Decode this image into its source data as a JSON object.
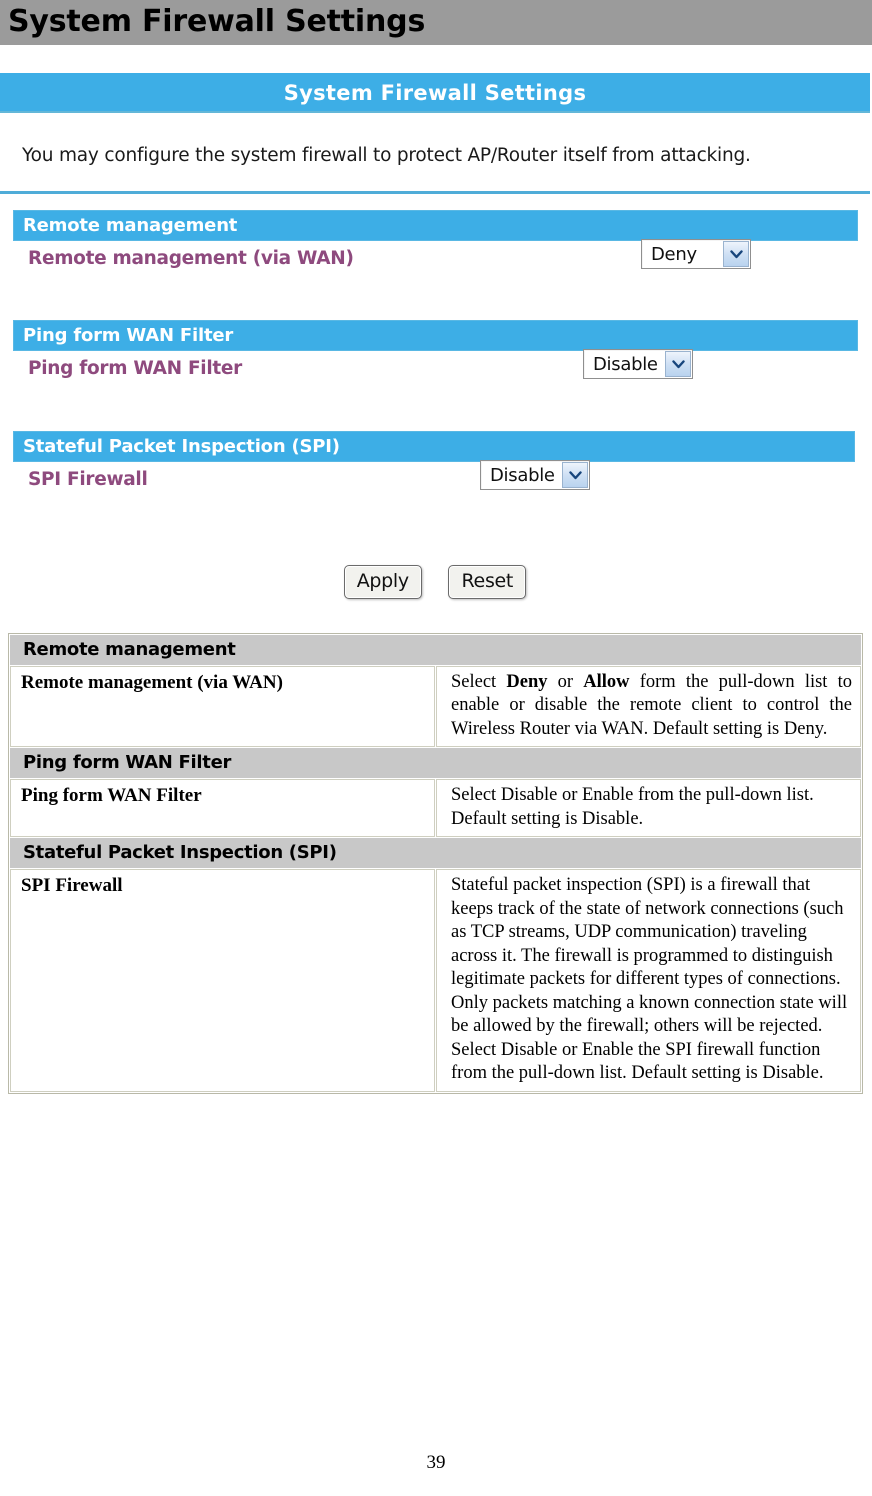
{
  "page": {
    "heading": "System Firewall Settings",
    "number": "39"
  },
  "router_ui": {
    "banner_title": "System Firewall Settings",
    "description": "You may configure the system firewall to protect AP/Router itself from attacking.",
    "sections": [
      {
        "bar_label": "Remote management",
        "field_label": "Remote management (via WAN)",
        "select_value": "Deny"
      },
      {
        "bar_label": "Ping form WAN Filter",
        "field_label": "Ping form WAN Filter",
        "select_value": "Disable"
      },
      {
        "bar_label": "Stateful Packet Inspection (SPI)",
        "field_label": "SPI Firewall",
        "select_value": "Disable"
      }
    ],
    "buttons": {
      "apply": "Apply",
      "reset": "Reset"
    }
  },
  "doc_table": {
    "groups": [
      {
        "header": "Remote management",
        "term": "Remote management (via WAN)",
        "desc_prefix": "Select ",
        "desc_bold1": "Deny",
        "desc_mid": " or ",
        "desc_bold2": "Allow",
        "desc_suffix": " form the pull-down list to enable or disable the remote client to control the Wireless  Router via WAN. Default setting is Deny."
      },
      {
        "header": "Ping form WAN Filter",
        "term": "Ping form WAN Filter",
        "desc": "Select Disable or Enable from the pull-down list. Default setting is Disable."
      },
      {
        "header": "Stateful Packet Inspection (SPI)",
        "term": "SPI Firewall",
        "desc_para1": "Stateful packet inspection (SPI) is a firewall that keeps track of the state of network connections (such as TCP streams, UDP communication) traveling across it. The firewall is programmed to distinguish legitimate packets for different types of connections. Only packets matching a known connection state will be allowed by the firewall; others will be rejected.",
        "desc_para2": "Select Disable or Enable the SPI firewall function from the pull-down list. Default setting is Disable."
      }
    ]
  },
  "colors": {
    "title_bar_gray": "#9b9b9b",
    "ui_blue": "#3daee6",
    "field_label_purple": "#8e4a7e",
    "table_header_gray": "#c8c8c8"
  }
}
